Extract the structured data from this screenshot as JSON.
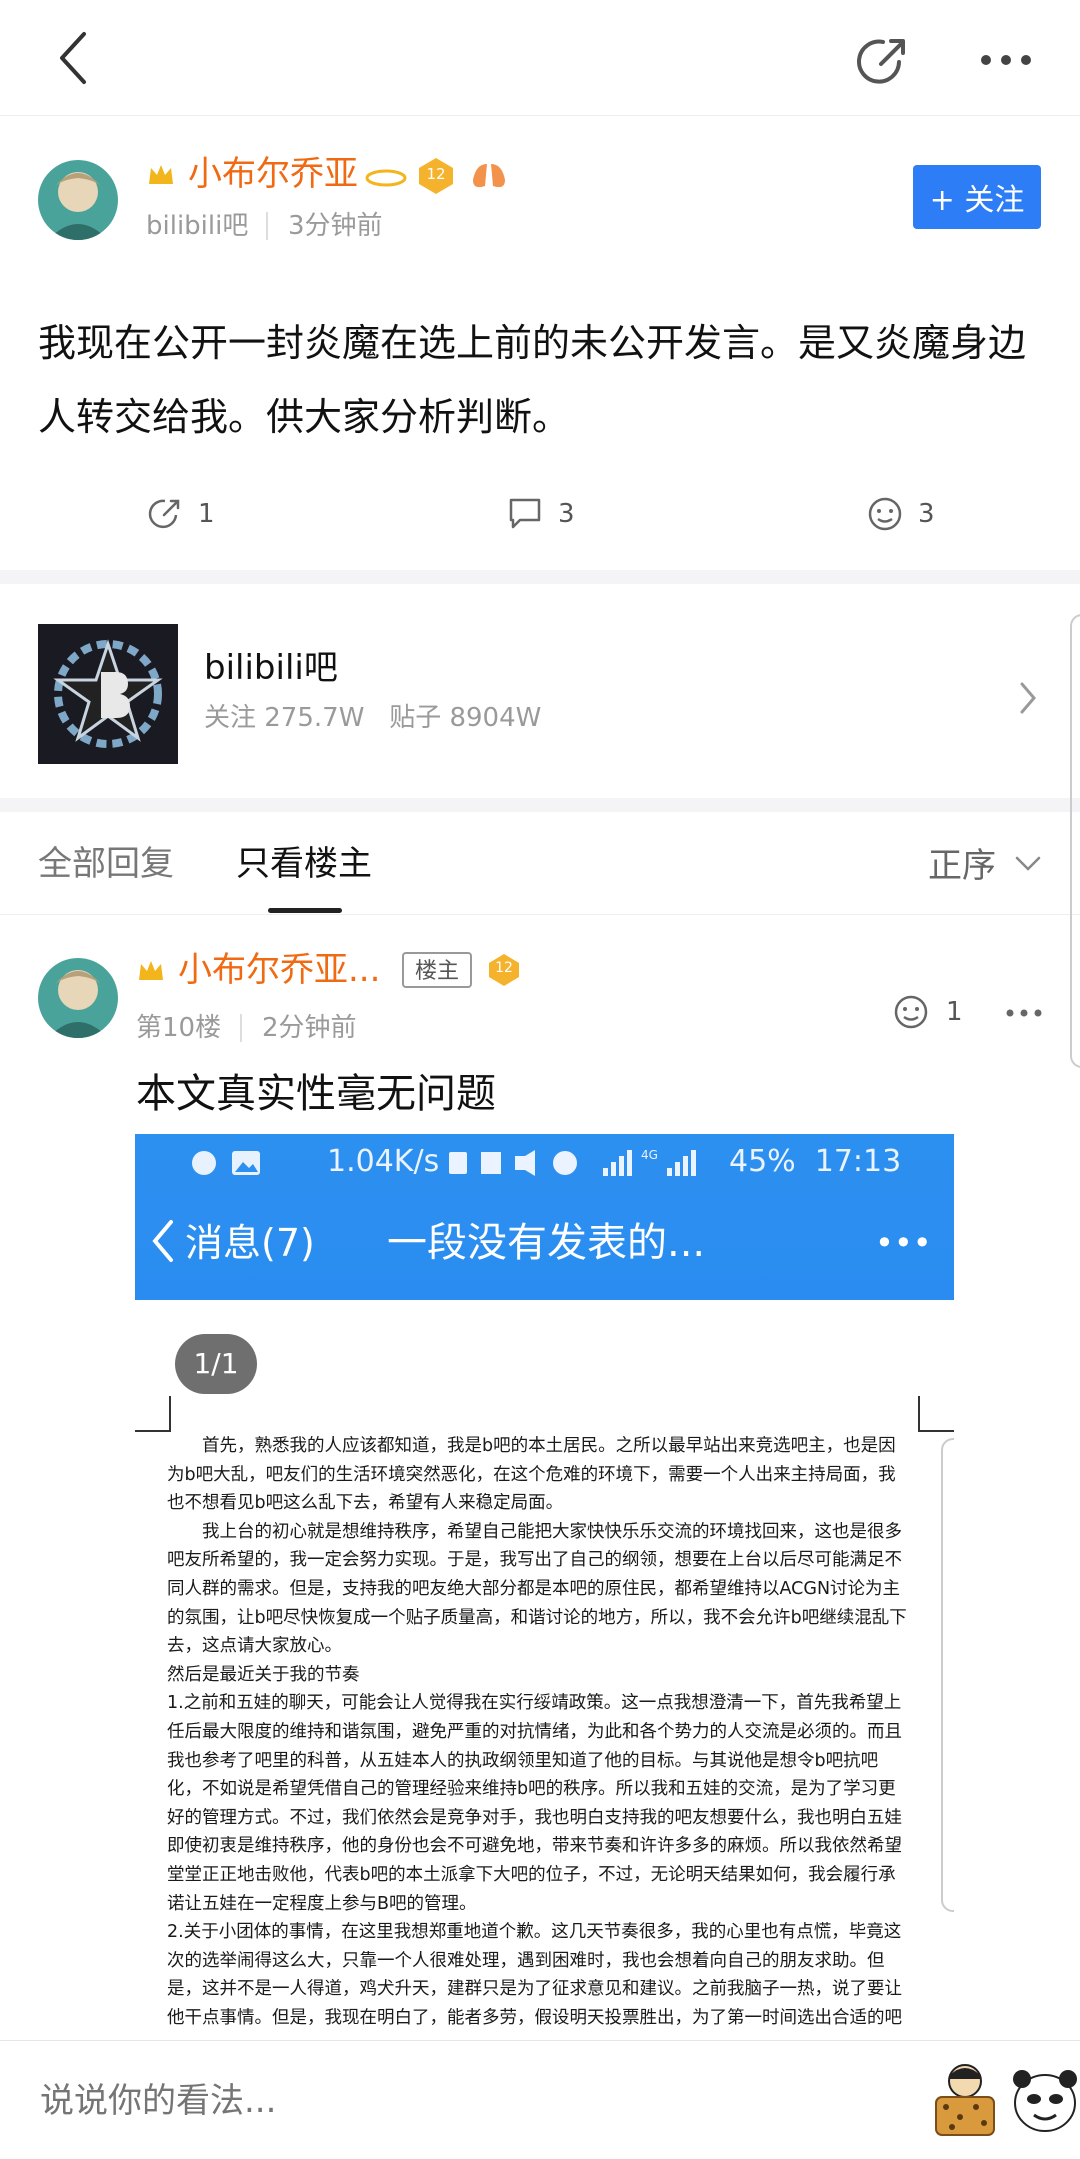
{
  "nav": {
    "back_icon": "back-arrow-icon",
    "share_icon": "share-icon",
    "more_icon": "more-dots-icon"
  },
  "post": {
    "author": "小布尔乔亚",
    "level": "12",
    "source": "bilibili吧",
    "time": "3分钟前",
    "follow_label": "+ 关注",
    "content": "我现在公开一封炎魔在选上前的未公开发言。是又炎魔身边人转交给我。供大家分析判断。",
    "shares": "1",
    "comments": "3",
    "likes": "3"
  },
  "forum": {
    "name": "bilibili吧",
    "stats": "关注 275.7W   贴子 8904W"
  },
  "tabs": {
    "all": "全部回复",
    "op_only": "只看楼主",
    "order": "正序"
  },
  "reply": {
    "author": "小布尔乔亚...",
    "op_badge": "楼主",
    "level": "12",
    "floor": "第10楼",
    "time": "2分钟前",
    "likes": "1",
    "text": "本文真实性毫无问题"
  },
  "phone_screenshot": {
    "status_left": "1.04K/s",
    "status_right": "45%  17:13",
    "net": "4G",
    "back_label": "消息(7)",
    "title": "一段没有发表的...",
    "more": "•••",
    "page_counter": "1/1",
    "lines": [
      "　　首先，熟悉我的人应该都知道，我是b吧的本土居民。之所以最早站出来竞选吧主，也是因",
      "为b吧大乱，吧友们的生活环境突然恶化，在这个危难的环境下，需要一个人出来主持局面，我",
      "也不想看见b吧这么乱下去，希望有人来稳定局面。",
      "　　我上台的初心就是想维持秩序，希望自己能把大家快快乐乐交流的环境找回来，这也是很多",
      "吧友所希望的，我一定会努力实现。于是，我写出了自己的纲领，想要在上台以后尽可能满足不",
      "同人群的需求。但是，支持我的吧友绝大部分都是本吧的原住民，都希望维持以ACGN讨论为主",
      "的氛围，让b吧尽快恢复成一个贴子质量高，和谐讨论的地方，所以，我不会允许b吧继续混乱下",
      "去，这点请大家放心。",
      "然后是最近关于我的节奏",
      "1.之前和五娃的聊天，可能会让人觉得我在实行绥靖政策。这一点我想澄清一下，首先我希望上",
      "任后最大限度的维持和谐氛围，避免严重的对抗情绪，为此和各个势力的人交流是必须的。而且",
      "我也参考了吧里的科普，从五娃本人的执政纲领里知道了他的目标。与其说他是想令b吧抗吧",
      "化，不如说是希望凭借自己的管理经验来维持b吧的秩序。所以我和五娃的交流，是为了学习更",
      "好的管理方式。不过，我们依然会是竞争对手，我也明白支持我的吧友想要什么，我也明白五娃",
      "即使初衷是维持秩序，他的身份也会不可避免地，带来节奏和许许多多的麻烦。所以我依然希望",
      "堂堂正正地击败他，代表b吧的本土派拿下大吧的位子，不过，无论明天结果如何，我会履行承",
      "诺让五娃在一定程度上参与B吧的管理。",
      "2.关于小团体的事情，在这里我想郑重地道个歉。这几天节奏很多，我的心里也有点慌，毕竟这",
      "次的选举闹得这么大，只靠一个人很难处理，遇到困难时，我也会想着向自己的朋友求助。但",
      "是，这并不是一人得道，鸡犬升天，建群只是为了征求意见和建议。之前我脑子一热，说了要让",
      "他干点事情。但是，我现在明白了，能者多劳，假设明天投票胜出，为了第一时间选出合适的吧"
    ]
  },
  "bottom": {
    "placeholder": "说说你的看法..."
  }
}
